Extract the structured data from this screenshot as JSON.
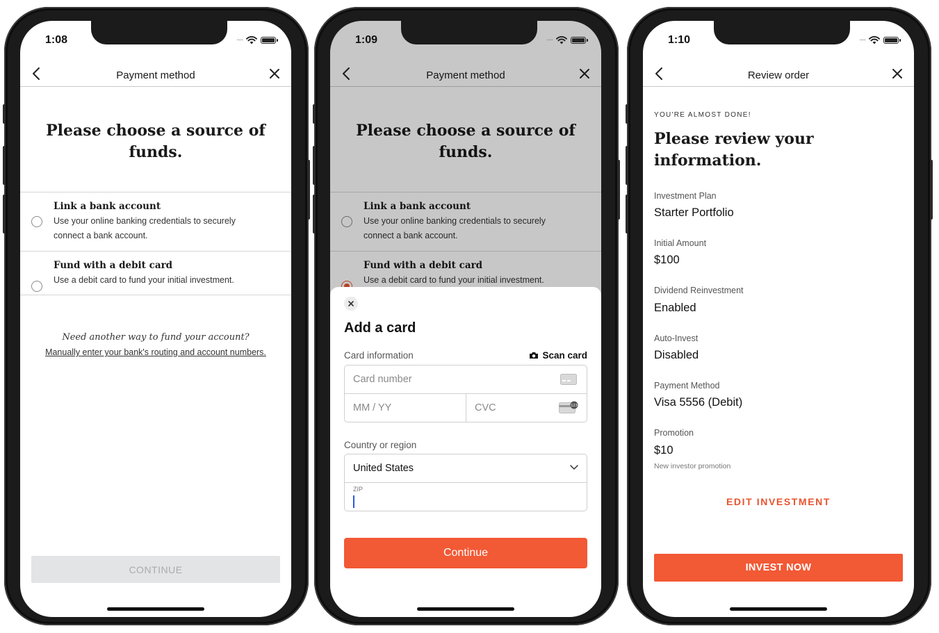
{
  "colors": {
    "accent": "#f25935",
    "disabled_bg": "#e3e4e6",
    "text": "#1a1a1a"
  },
  "screen1": {
    "time": "1:08",
    "nav_title": "Payment method",
    "heading": "Please choose a source of funds.",
    "options": [
      {
        "title": "Link a bank account",
        "desc": "Use your online banking credentials to securely connect a bank account.",
        "selected": false
      },
      {
        "title": "Fund with a debit card",
        "desc": "Use a debit card to fund your initial investment.",
        "selected": false
      }
    ],
    "alt_prompt": "Need another way to fund your account?",
    "alt_link": "Manually enter your bank's routing and account numbers.",
    "continue_label": "CONTINUE"
  },
  "screen2": {
    "time": "1:09",
    "nav_title": "Payment method",
    "heading": "Please choose a source of funds.",
    "options": [
      {
        "title": "Link a bank account",
        "desc": "Use your online banking credentials to securely connect a bank account.",
        "selected": false
      },
      {
        "title": "Fund with a debit card",
        "desc": "Use a debit card to fund your initial investment.",
        "selected": true
      }
    ],
    "sheet": {
      "title": "Add a card",
      "card_info_label": "Card information",
      "scan_label": "Scan card",
      "card_number_placeholder": "Card number",
      "expiry_placeholder": "MM / YY",
      "cvc_placeholder": "CVC",
      "country_label": "Country or region",
      "country_value": "United States",
      "zip_label": "ZIP",
      "continue_label": "Continue"
    }
  },
  "screen3": {
    "time": "1:10",
    "nav_title": "Review order",
    "eyebrow": "YOU'RE ALMOST DONE!",
    "heading": "Please review your information.",
    "fields": [
      {
        "label": "Investment Plan",
        "value": "Starter Portfolio"
      },
      {
        "label": "Initial Amount",
        "value": "$100"
      },
      {
        "label": "Dividend Reinvestment",
        "value": "Enabled"
      },
      {
        "label": "Auto-Invest",
        "value": "Disabled"
      },
      {
        "label": "Payment Method",
        "value": "Visa 5556 (Debit)"
      },
      {
        "label": "Promotion",
        "value": "$10",
        "note": "New investor promotion"
      }
    ],
    "edit_label": "EDIT INVESTMENT",
    "invest_label": "INVEST NOW"
  }
}
